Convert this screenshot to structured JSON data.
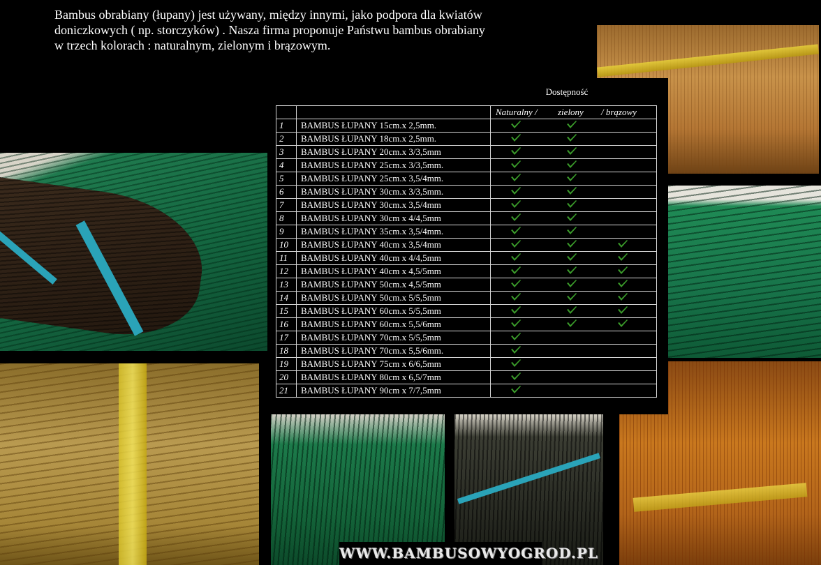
{
  "intro_text": "Bambus obrabiany (łupany) jest używany, między innymi, jako podpora dla kwiatów doniczkowych ( np. storczyków) . Nasza  firma proponuje Państwu bambus obrabiany w trzech kolorach : naturalnym, zielonym i brązowym.",
  "availability": {
    "title": "Dostępność",
    "headers": [
      "Naturalny /",
      "zielony",
      "/ brązowy"
    ],
    "check_color": "#3a9b2a",
    "rows": [
      {
        "num": "1",
        "name": "BAMBUS ŁUPANY 15cm.x 2,5mm.",
        "natural": true,
        "green": true,
        "brown": false
      },
      {
        "num": "2",
        "name": "BAMBUS ŁUPANY 18cm.x 2,5mm.",
        "natural": true,
        "green": true,
        "brown": false
      },
      {
        "num": "3",
        "name": "BAMBUS ŁUPANY 20cm.x 3/3,5mm",
        "natural": true,
        "green": true,
        "brown": false
      },
      {
        "num": "4",
        "name": "BAMBUS ŁUPANY 25cm.x 3/3,5mm.",
        "natural": true,
        "green": true,
        "brown": false
      },
      {
        "num": "5",
        "name": "BAMBUS ŁUPANY 25cm.x 3,5/4mm.",
        "natural": true,
        "green": true,
        "brown": false
      },
      {
        "num": "6",
        "name": "BAMBUS ŁUPANY 30cm.x 3/3,5mm.",
        "natural": true,
        "green": true,
        "brown": false
      },
      {
        "num": "7",
        "name": "BAMBUS ŁUPANY 30cm.x 3,5/4mm",
        "natural": true,
        "green": true,
        "brown": false
      },
      {
        "num": "8",
        "name": "BAMBUS ŁUPANY 30cm x 4/4,5mm",
        "natural": true,
        "green": true,
        "brown": false
      },
      {
        "num": "9",
        "name": "BAMBUS ŁUPANY 35cm.x 3,5/4mm.",
        "natural": true,
        "green": true,
        "brown": false
      },
      {
        "num": "10",
        "name": "BAMBUS ŁUPANY 40cm x 3,5/4mm",
        "natural": true,
        "green": true,
        "brown": true
      },
      {
        "num": "11",
        "name": "BAMBUS ŁUPANY 40cm x 4/4,5mm",
        "natural": true,
        "green": true,
        "brown": true
      },
      {
        "num": "12",
        "name": "BAMBUS ŁUPANY 40cm x 4,5/5mm",
        "natural": true,
        "green": true,
        "brown": true
      },
      {
        "num": "13",
        "name": "BAMBUS ŁUPANY 50cm.x 4,5/5mm",
        "natural": true,
        "green": true,
        "brown": true
      },
      {
        "num": "14",
        "name": "BAMBUS ŁUPANY 50cm.x 5/5,5mm",
        "natural": true,
        "green": true,
        "brown": true
      },
      {
        "num": "15",
        "name": "BAMBUS ŁUPANY 60cm.x 5/5,5mm",
        "natural": true,
        "green": true,
        "brown": true
      },
      {
        "num": "16",
        "name": "BAMBUS ŁUPANY 60cm.x 5,5/6mm",
        "natural": true,
        "green": true,
        "brown": true
      },
      {
        "num": "17",
        "name": "BAMBUS ŁUPANY 70cm.x 5/5,5mm",
        "natural": true,
        "green": false,
        "brown": false
      },
      {
        "num": "18",
        "name": "BAMBUS ŁUPANY 70cm.x 5,5/6mm.",
        "natural": true,
        "green": false,
        "brown": false
      },
      {
        "num": "19",
        "name": "BAMBUS ŁUPANY 75cm x 6/6,5mm",
        "natural": true,
        "green": false,
        "brown": false
      },
      {
        "num": "20",
        "name": "BAMBUS ŁUPANY 80cm x 6,5/7mm",
        "natural": true,
        "green": false,
        "brown": false
      },
      {
        "num": "21",
        "name": "BAMBUS ŁUPANY 90cm x 7/7,5mm",
        "natural": true,
        "green": false,
        "brown": false
      }
    ]
  },
  "website": "WWW.BAMBUSOWYOGROD.PL"
}
